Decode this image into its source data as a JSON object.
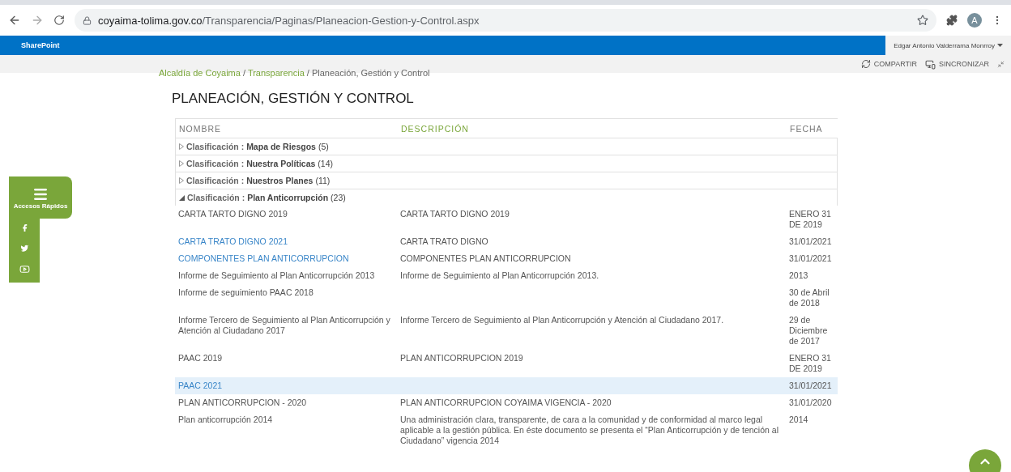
{
  "browser": {
    "url_host": "coyaima-tolima.gov.co",
    "url_path": "/Transparencia/Paginas/Planeacion-Gestion-y-Control.aspx",
    "profile_initial": "A"
  },
  "suite_bar": {
    "brand": "SharePoint",
    "user": "Edgar Antonio Valderrama Monrroy"
  },
  "actions": [
    {
      "kind": "share",
      "label": "COMPARTIR"
    },
    {
      "kind": "sync",
      "label": "SINCRONIZAR"
    }
  ],
  "quick_access": {
    "label": "Accesos Rápidos",
    "links": [
      {
        "kind": "facebook"
      },
      {
        "kind": "twitter"
      },
      {
        "kind": "youtube"
      }
    ]
  },
  "breadcrumb": {
    "separator": "/",
    "items": [
      {
        "label": "Alcaldía de Coyaima",
        "link": true
      },
      {
        "label": "Transparencia",
        "link": true
      },
      {
        "label": "Planeación, Gestión y Control",
        "link": false
      }
    ]
  },
  "title": "PLANEACIÓN, GESTIÓN Y CONTROL",
  "table": {
    "columns": [
      {
        "label": "NOMBRE",
        "sorted": false
      },
      {
        "label": "DESCRIPCIÓN",
        "sorted": true
      },
      {
        "label": "FECHA",
        "sorted": false
      }
    ],
    "groups": [
      {
        "field": "Clasificación :",
        "value": "Mapa de Riesgos",
        "count": "(5)",
        "expanded": false
      },
      {
        "field": "Clasificación :",
        "value": "Nuestra Políticas",
        "count": "(14)",
        "expanded": false
      },
      {
        "field": "Clasificación :",
        "value": "Nuestros Planes",
        "count": "(11)",
        "expanded": false
      },
      {
        "field": "Clasificación :",
        "value": "Plan Anticorrupción",
        "count": "(23)",
        "expanded": true
      }
    ],
    "rows": [
      {
        "name": "CARTA TARTO DIGNO 2019",
        "link": false,
        "description": "CARTA TARTO DIGNO 2019",
        "date": "ENERO 31 DE 2019",
        "selected": false
      },
      {
        "name": "CARTA TRATO DIGNO 2021",
        "link": true,
        "description": "CARTA TRATO DIGNO",
        "date": "31/01/2021",
        "selected": false
      },
      {
        "name": "COMPONENTES PLAN ANTICORRUPCION",
        "link": true,
        "description": "COMPONENTES PLAN ANTICORRUPCION",
        "date": "31/01/2021",
        "selected": false
      },
      {
        "name": "Informe de Seguimiento al Plan Anticorrupción 2013",
        "link": false,
        "description": "Informe de Seguimiento al Plan Anticorrupción 2013.",
        "date": "2013",
        "selected": false
      },
      {
        "name": "Informe de seguimiento PAAC 2018",
        "link": false,
        "date": "30 de Abril de 2018",
        "selected": false
      },
      {
        "name": "Informe Tercero de Seguimiento al Plan Anticorrupción y Atención al Ciudadano 2017",
        "link": false,
        "description": "Informe Tercero de Seguimiento al Plan Anticorrupción y Atención al Ciudadano 2017.",
        "date": "29 de Diciembre de 2017",
        "selected": false
      },
      {
        "name": "PAAC 2019",
        "link": false,
        "description": "PLAN  ANTICORRUPCION 2019",
        "date": "ENERO 31 DE 2019",
        "selected": false
      },
      {
        "name": "PAAC 2021",
        "link": true,
        "date": "31/01/2021",
        "selected": true
      },
      {
        "name": "PLAN ANTICORRUPCION - 2020",
        "link": false,
        "description": "PLAN ANTICORRUPCION COYAIMA VIGENCIA - 2020",
        "date": "31/01/2020",
        "selected": false
      },
      {
        "name": "Plan anticorrupción 2014",
        "link": false,
        "description": "Una administración clara, transparente, de cara a la comunidad y de conformidad al marco legal aplicable a la gestión pública. En éste documento se presenta el “Plan Anticorrupción y de tención al Ciudadano” vigencia 2014",
        "date": "2014",
        "selected": false
      }
    ]
  }
}
